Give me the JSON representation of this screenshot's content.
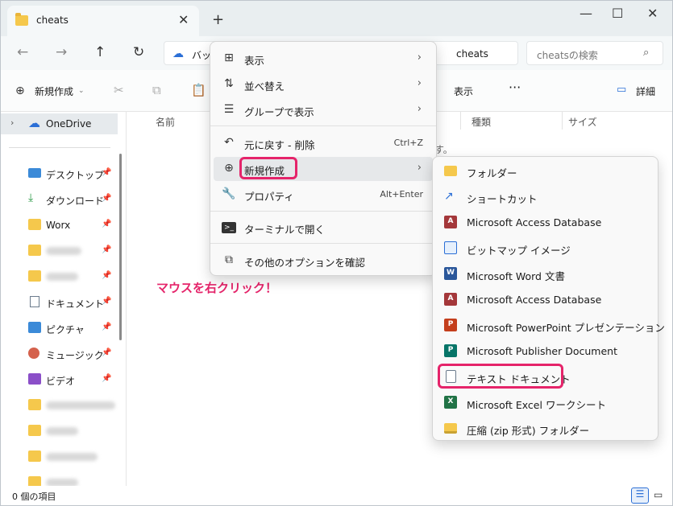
{
  "window": {
    "tab_title": "cheats",
    "tab_close": "✕",
    "new_tab": "+",
    "minimize": "—",
    "maximize": "☐",
    "close": "✕"
  },
  "nav": {
    "back": "←",
    "forward": "→",
    "up": "↑",
    "refresh": "↻",
    "address_prefix": "バッ",
    "address_segment": "cheats",
    "search_placeholder": "cheatsの検索",
    "search_icon": "⌕"
  },
  "toolbar": {
    "new_label": "新規作成",
    "view_label": "表示",
    "more_label": "···",
    "detail_label": "詳細"
  },
  "sidebar": {
    "onedrive": "OneDrive",
    "items": [
      {
        "label": "デスクトップ",
        "icon": "desktop-icon",
        "pinned": true
      },
      {
        "label": "ダウンロード",
        "icon": "download-icon",
        "pinned": true
      },
      {
        "label": "Worx",
        "icon": "folder-icon",
        "pinned": true
      },
      {
        "label": "",
        "icon": "folder-icon",
        "pinned": true
      },
      {
        "label": "",
        "icon": "folder-icon",
        "pinned": true
      },
      {
        "label": "ドキュメント",
        "icon": "documents-icon",
        "pinned": true
      },
      {
        "label": "ピクチャ",
        "icon": "pictures-icon",
        "pinned": true
      },
      {
        "label": "ミュージック",
        "icon": "music-icon",
        "pinned": true
      },
      {
        "label": "ビデオ",
        "icon": "video-icon",
        "pinned": true
      },
      {
        "label": "",
        "icon": "folder-icon",
        "pinned": false
      },
      {
        "label": "",
        "icon": "folder-icon",
        "pinned": false
      },
      {
        "label": "",
        "icon": "folder-icon",
        "pinned": false
      },
      {
        "label": "",
        "icon": "folder-icon",
        "pinned": false
      }
    ]
  },
  "columns": {
    "name": "名前",
    "type": "種類",
    "size": "サイズ",
    "empty_tail": "す。"
  },
  "status": {
    "item_count": "0 個の項目"
  },
  "context_menu": {
    "items": [
      {
        "label": "表示",
        "icon": "grid-icon",
        "shortcut": "",
        "submenu": true
      },
      {
        "label": "並べ替え",
        "icon": "sort-icon",
        "shortcut": "",
        "submenu": true
      },
      {
        "label": "グループで表示",
        "icon": "group-icon",
        "shortcut": "",
        "submenu": true
      },
      {
        "label": "元に戻す - 削除",
        "icon": "undo-icon",
        "shortcut": "Ctrl+Z",
        "submenu": false
      },
      {
        "label": "新規作成",
        "icon": "new-icon",
        "shortcut": "",
        "submenu": true
      },
      {
        "label": "プロパティ",
        "icon": "wrench-icon",
        "shortcut": "Alt+Enter",
        "submenu": false
      },
      {
        "label": "ターミナルで開く",
        "icon": "terminal-icon",
        "shortcut": "",
        "submenu": false
      },
      {
        "label": "その他のオプションを確認",
        "icon": "more-options-icon",
        "shortcut": "",
        "submenu": false
      }
    ]
  },
  "submenu": {
    "items": [
      {
        "label": "フォルダー",
        "icon": "folder-icon"
      },
      {
        "label": "ショートカット",
        "icon": "shortcut-icon"
      },
      {
        "label": "Microsoft Access Database",
        "icon": "access-icon"
      },
      {
        "label": "ビットマップ イメージ",
        "icon": "bitmap-icon"
      },
      {
        "label": "Microsoft Word 文書",
        "icon": "word-icon"
      },
      {
        "label": "Microsoft Access Database",
        "icon": "access-icon"
      },
      {
        "label": "Microsoft PowerPoint プレゼンテーション",
        "icon": "powerpoint-icon"
      },
      {
        "label": "Microsoft Publisher Document",
        "icon": "publisher-icon"
      },
      {
        "label": "テキスト ドキュメント",
        "icon": "text-document-icon"
      },
      {
        "label": "Microsoft Excel ワークシート",
        "icon": "excel-icon"
      },
      {
        "label": "圧縮 (zip 形式) フォルダー",
        "icon": "zip-folder-icon"
      }
    ]
  },
  "annotation": "マウスを右クリック！",
  "colors": {
    "accent": "#2b6fd6",
    "highlight": "#e5246a",
    "folder": "#f5c84c"
  }
}
